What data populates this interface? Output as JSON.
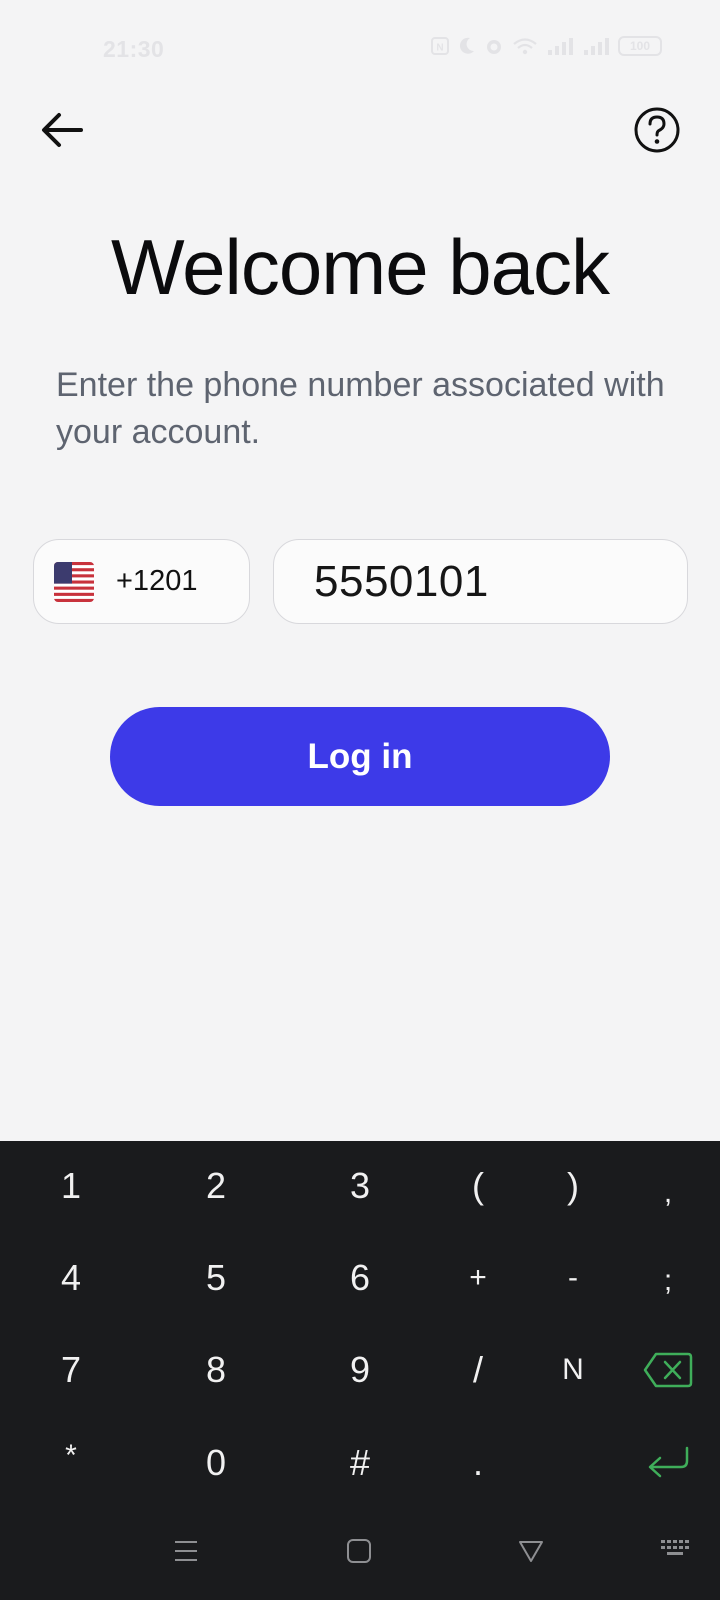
{
  "status_bar": {
    "time": "21:30",
    "battery": "100"
  },
  "header": {
    "back_icon": "arrow-left-icon",
    "help_icon": "question-circle-icon"
  },
  "main": {
    "title": "Welcome back",
    "subtitle": "Enter the phone number associated with your account.",
    "country": {
      "flag": "us-flag-icon",
      "code": "+1201"
    },
    "phone_value": "5550101",
    "login_label": "Log in"
  },
  "colors": {
    "background": "#f4f4f5",
    "primary_button": "#3d3ae8",
    "keyboard_bg": "#1a1b1d",
    "keyboard_accent": "#3fae5a"
  },
  "keyboard": {
    "row1": [
      "1",
      "2",
      "3",
      "(",
      ")",
      ","
    ],
    "row2": [
      "4",
      "5",
      "6",
      "+",
      "-",
      ";"
    ],
    "row3": [
      "7",
      "8",
      "9",
      "/",
      "N"
    ],
    "row4": [
      "*",
      "0",
      "#",
      "."
    ],
    "backspace_icon": "backspace-icon",
    "enter_icon": "enter-icon"
  },
  "system_nav": {
    "recents_icon": "menu-lines-icon",
    "home_icon": "square-icon",
    "back_icon": "triangle-back-icon",
    "keyboard_icon": "keyboard-icon"
  }
}
